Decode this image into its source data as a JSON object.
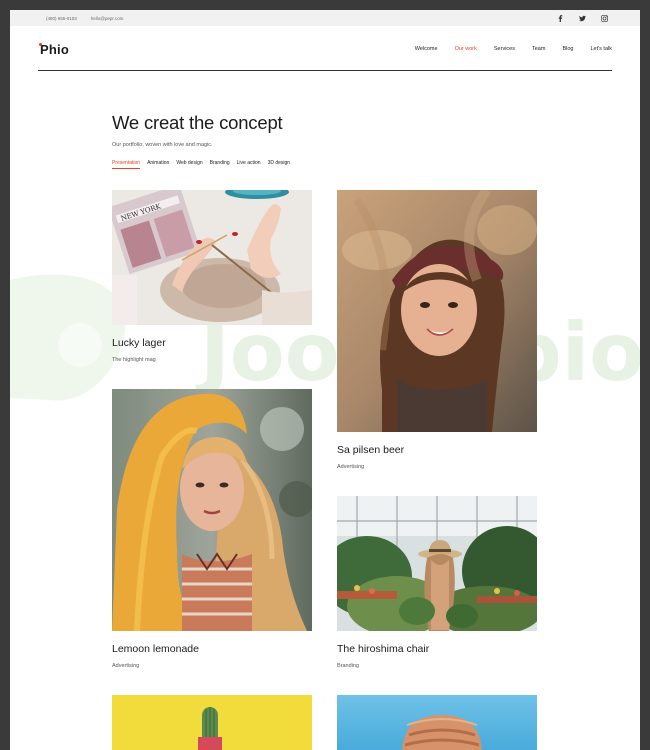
{
  "topbar": {
    "phone": "(480) 555-0103",
    "email": "hello@pepr.com",
    "social": [
      "facebook-icon",
      "twitter-icon",
      "instagram-icon"
    ]
  },
  "header": {
    "logo": "Phio",
    "nav": [
      "Welcome",
      "Our work",
      "Services",
      "Team",
      "Blog",
      "Let's talk"
    ],
    "active_nav": "Our work"
  },
  "hero": {
    "title": "We creat the concept",
    "subtitle": "Our portfolio, woven with love and magic.",
    "filters": [
      "Presentation",
      "Animation",
      "Web design",
      "Branding",
      "Live action",
      "3D design"
    ],
    "active_filter": "Presentation"
  },
  "watermark": {
    "text": "Joomlabio"
  },
  "portfolio": [
    {
      "title": "Lucky lager",
      "category": "The highlight mag"
    },
    {
      "title": "Sa pilsen beer",
      "category": "Advertising"
    },
    {
      "title": "Lemoon lemonade",
      "category": "Advertising"
    },
    {
      "title": "The hiroshima chair",
      "category": "Branding"
    }
  ],
  "colors": {
    "accent": "#e5452b",
    "page_bg": "#3a3a3a",
    "topbar_bg": "#f1f1f1"
  }
}
